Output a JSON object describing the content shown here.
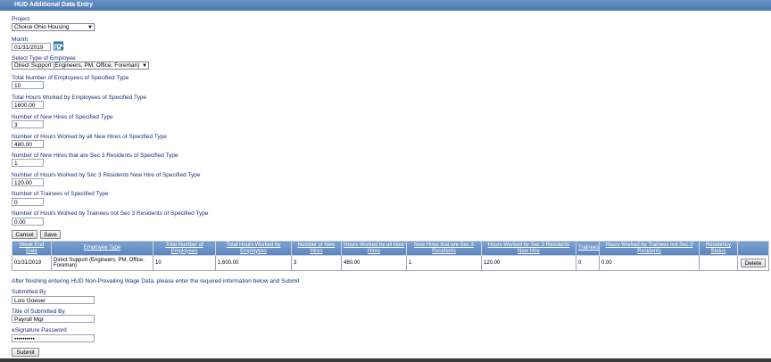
{
  "window": {
    "title": "HUD Additional Data Entry"
  },
  "form": {
    "project": {
      "label": "Project",
      "value": "Choice Ohio Housing"
    },
    "month": {
      "label": "Month",
      "value": "01/31/2019"
    },
    "employee_type": {
      "label": "Select Type of Employee",
      "value": "Direct Support (Engineers, PM, Office, Foreman)"
    },
    "total_employees": {
      "label": "Total Number of Employees of Specified Type",
      "value": "10"
    },
    "total_hours": {
      "label": "Total Hours Worked by Employees of Specified Type",
      "value": "1600.00"
    },
    "new_hires": {
      "label": "Number of New Hires of Specified Type",
      "value": "3"
    },
    "new_hire_hours": {
      "label": "Number of Hours Worked by all New Hires of Specified Type",
      "value": "480.00"
    },
    "sec3_new_hires": {
      "label": "Number of New Hires that are Sec 3 Residents of Specified Type",
      "value": "1"
    },
    "sec3_hours": {
      "label": "Number of Hours Worked by Sec 3 Residents New Hire of Specified Type",
      "value": "120.00"
    },
    "trainees": {
      "label": "Number of Trainees of Specified Type",
      "value": "0"
    },
    "trainee_hours": {
      "label": "Number of Hours Worked by Trainees not Sec 3 Residents of Specified Type",
      "value": "0.00"
    }
  },
  "buttons": {
    "cancel": "Cancel",
    "save": "Save",
    "delete": "Delete",
    "submit": "Submit"
  },
  "table": {
    "headers": [
      "Week End Date",
      "Employee Type",
      "Total Number of Employees",
      "Total Hours Worked by Employees",
      "Number of New Hires",
      "Hours Worked by all New Hires",
      "New Hires that are Sec 3 Residents",
      "Hours Worked by Sec 3 Residents New Hire",
      "Trainees",
      "Hours Worked by Trainees not Sec 3 Residents",
      "Residency Status",
      ""
    ],
    "rows": [
      [
        "01/31/2019",
        "Direct Support (Engineers, PM, Office, Foreman)",
        "10",
        "1,600.00",
        "3",
        "480.00",
        "1",
        "120.00",
        "0",
        "0.00",
        ""
      ]
    ]
  },
  "note": "After finishing entering HUD Non-Prevailing Wage Data, please enter the required information below and Submit",
  "submission": {
    "submitted_by": {
      "label": "Submitted By",
      "value": "Lois Goeser"
    },
    "title": {
      "label": "Title of Submitted By",
      "value": "Payroll Mgr"
    },
    "esignature": {
      "label": "eSignature Password",
      "value": "••••••••••"
    }
  }
}
